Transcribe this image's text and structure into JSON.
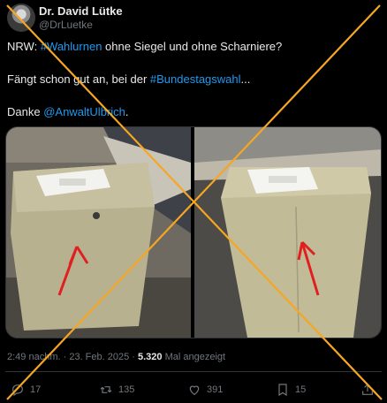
{
  "author": {
    "name": "Dr. David Lütke",
    "handle": "@DrLuetke"
  },
  "tweet": {
    "line1_label": "NRW: ",
    "line1_hashtag": "#Wahlurnen",
    "line1_rest": " ohne Siegel und ohne Scharniere?",
    "line2_pre": "Fängt schon gut an, bei der ",
    "line2_hashtag": "#Bundestagswahl",
    "line2_post": "...",
    "line3_pre": "Danke ",
    "line3_mention": "@AnwaltUlbrich",
    "line3_post": "."
  },
  "meta": {
    "time": "2:49 nachm.",
    "separator": " · ",
    "date": "23. Feb. 2025",
    "views_count": "5.320",
    "views_label": " Mal angezeigt"
  },
  "actions": {
    "replies": "17",
    "reposts": "135",
    "likes": "391",
    "bookmarks": "15"
  },
  "colors": {
    "background": "#000000",
    "link": "#1d9bf0",
    "muted": "#71767b",
    "cross": "#f5a623"
  }
}
